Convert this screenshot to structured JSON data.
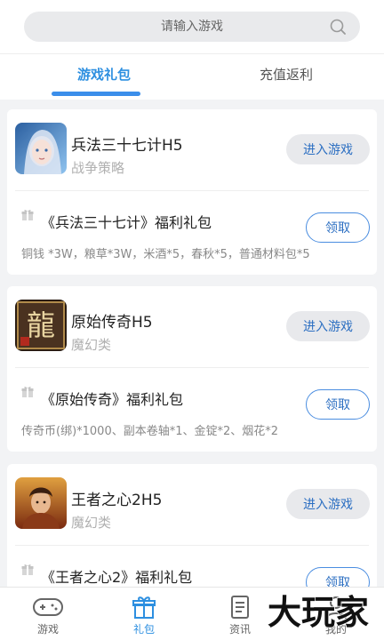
{
  "search": {
    "placeholder": "请输入游戏"
  },
  "tabs": [
    {
      "label": "游戏礼包",
      "active": true
    },
    {
      "label": "充值返利",
      "active": false
    }
  ],
  "games": [
    {
      "name": "兵法三十七计H5",
      "category": "战争策略",
      "enter_label": "进入游戏",
      "pack_title": "《兵法三十七计》福利礼包",
      "claim_label": "领取",
      "pack_contents": "铜钱 *3W，粮草*3W，米酒*5，春秋*5，普通材料包*5"
    },
    {
      "name": "原始传奇H5",
      "category": "魔幻类",
      "enter_label": "进入游戏",
      "pack_title": "《原始传奇》福利礼包",
      "claim_label": "领取",
      "pack_contents": "传奇币(绑)*1000、副本卷轴*1、金锭*2、烟花*2"
    },
    {
      "name": "王者之心2H5",
      "category": "魔幻类",
      "enter_label": "进入游戏",
      "pack_title": "《王者之心2》福利礼包",
      "claim_label": "领取",
      "pack_contents": ""
    }
  ],
  "nav": [
    {
      "label": "游戏",
      "icon": "gamepad-icon",
      "active": false
    },
    {
      "label": "礼包",
      "icon": "gift-icon",
      "active": true
    },
    {
      "label": "资讯",
      "icon": "news-icon",
      "active": false
    },
    {
      "label": "我的",
      "icon": "user-icon",
      "active": false
    }
  ],
  "watermark": {
    "text": "大玩家"
  },
  "colors": {
    "accent": "#2d8fe0",
    "background": "#f2f3f5"
  }
}
